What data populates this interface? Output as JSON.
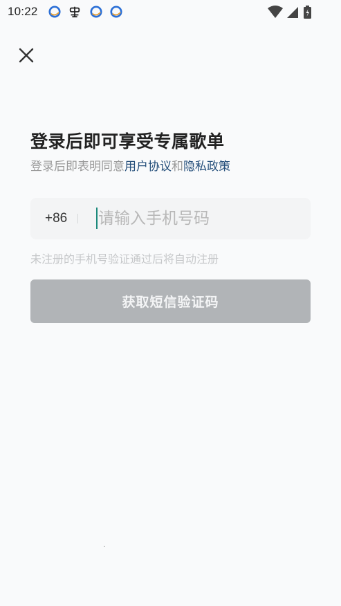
{
  "status_bar": {
    "time": "10:22",
    "notification_icons": [
      "qq-browser-icon",
      "bug-icon",
      "qq-browser-icon",
      "qq-browser-icon"
    ],
    "right_icons": [
      "wifi-icon",
      "signal-icon",
      "battery-charging-icon"
    ]
  },
  "header": {
    "close_icon": "close-icon"
  },
  "login": {
    "title": "登录后即可享受专属歌单",
    "agreement_prefix": "登录后即表明同意",
    "user_agreement_link": "用户协议",
    "agreement_and": "和",
    "privacy_policy_link": "隐私政策",
    "country_code": "+86",
    "phone_placeholder": "请输入手机号码",
    "phone_value": "",
    "register_hint": "未注册的手机号验证通过后将自动注册",
    "get_code_button": "获取短信验证码"
  },
  "colors": {
    "background": "#f9fafb",
    "link": "#244e7a",
    "caret": "#1c8a7c",
    "button_disabled": "#b1b4b7",
    "input_bg": "#f3f4f5"
  }
}
